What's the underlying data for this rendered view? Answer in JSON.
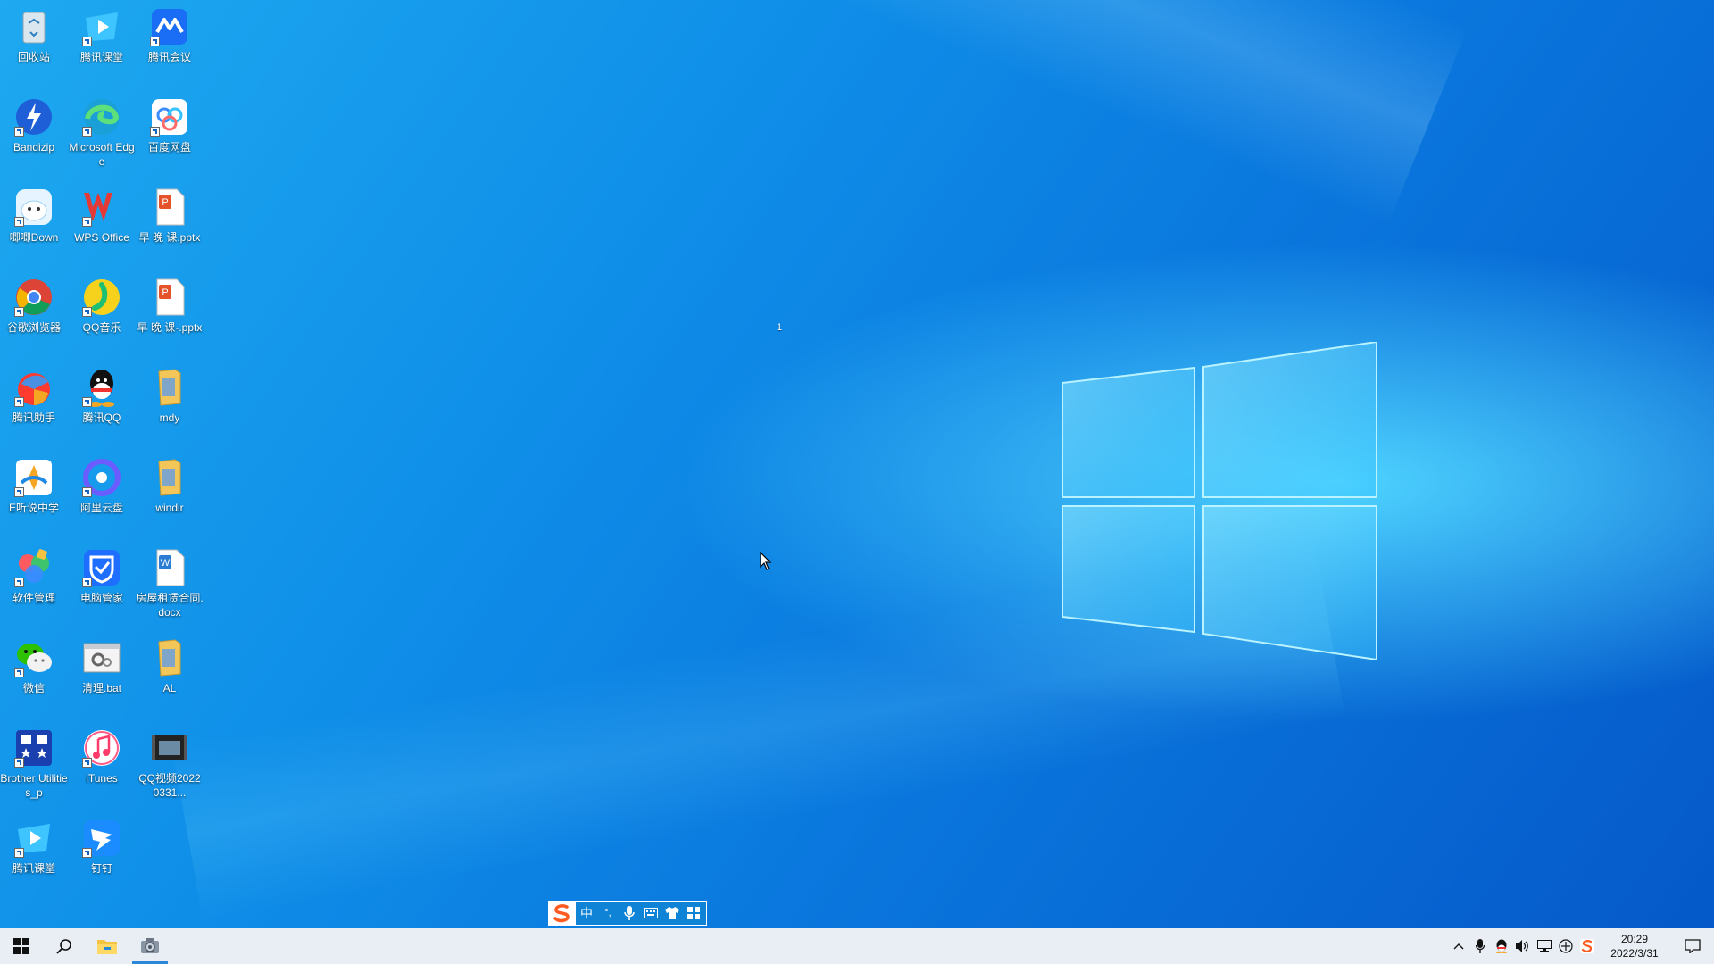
{
  "desktop": {
    "center_text": "1",
    "icons": [
      {
        "label": "回收站",
        "icon": "recycle-bin-icon",
        "shortcut": false
      },
      {
        "label": "腾讯课堂",
        "icon": "tencent-classroom-icon",
        "shortcut": true
      },
      {
        "label": "腾讯会议",
        "icon": "tencent-meeting-icon",
        "shortcut": true
      },
      {
        "label": "Bandizip",
        "icon": "bandizip-icon",
        "shortcut": true
      },
      {
        "label": "Microsoft Edge",
        "icon": "edge-icon",
        "shortcut": true
      },
      {
        "label": "百度网盘",
        "icon": "baidu-netdisk-icon",
        "shortcut": true
      },
      {
        "label": "唧唧Down",
        "icon": "jijidown-icon",
        "shortcut": true
      },
      {
        "label": "WPS Office",
        "icon": "wps-office-icon",
        "shortcut": true
      },
      {
        "label": "早 晚 课.pptx",
        "icon": "pptx-file-icon",
        "shortcut": false
      },
      {
        "label": "谷歌浏览器",
        "icon": "chrome-icon",
        "shortcut": true
      },
      {
        "label": "QQ音乐",
        "icon": "qq-music-icon",
        "shortcut": true
      },
      {
        "label": "早 晚 课-.pptx",
        "icon": "pptx-file-icon",
        "shortcut": false
      },
      {
        "label": "腾讯助手",
        "icon": "tencent-assistant-icon",
        "shortcut": true
      },
      {
        "label": "腾讯QQ",
        "icon": "qq-icon",
        "shortcut": true
      },
      {
        "label": "mdy",
        "icon": "folder-icon",
        "shortcut": false
      },
      {
        "label": "E听说中学",
        "icon": "etingshuo-icon",
        "shortcut": true
      },
      {
        "label": "阿里云盘",
        "icon": "aliyun-drive-icon",
        "shortcut": true
      },
      {
        "label": "windir",
        "icon": "folder-icon",
        "shortcut": false
      },
      {
        "label": "软件管理",
        "icon": "software-manager-icon",
        "shortcut": true
      },
      {
        "label": "电脑管家",
        "icon": "pc-manager-icon",
        "shortcut": true
      },
      {
        "label": "房屋租赁合同.docx",
        "icon": "docx-file-icon",
        "shortcut": false
      },
      {
        "label": "微信",
        "icon": "wechat-icon",
        "shortcut": true
      },
      {
        "label": "清理.bat",
        "icon": "bat-file-icon",
        "shortcut": false
      },
      {
        "label": "AL",
        "icon": "folder-icon",
        "shortcut": false
      },
      {
        "label": "Brother Utilities_p",
        "icon": "brother-utilities-icon",
        "shortcut": true
      },
      {
        "label": "iTunes",
        "icon": "itunes-icon",
        "shortcut": true
      },
      {
        "label": "QQ视频20220331...",
        "icon": "video-file-icon",
        "shortcut": false
      },
      {
        "label": "腾讯课堂",
        "icon": "tencent-classroom-icon",
        "shortcut": true
      },
      {
        "label": "钉钉",
        "icon": "dingtalk-icon",
        "shortcut": true
      }
    ]
  },
  "ime_bar": {
    "logo": "sogou-ime-icon",
    "mode": "中",
    "punct": "°,",
    "items": [
      "microphone-icon",
      "keyboard-icon",
      "skin-icon",
      "toolbox-icon"
    ]
  },
  "taskbar": {
    "start": "windows-start-icon",
    "search": "search-icon",
    "pinned": [
      "file-explorer-icon",
      "camera-app-icon"
    ],
    "tray": [
      "chevron-up-icon",
      "microphone-icon",
      "qq-tray-icon",
      "volume-icon",
      "network-icon",
      "input-method-icon",
      "sogou-tray-icon"
    ],
    "clock_time": "20:29",
    "clock_date": "2022/3/31",
    "notification": "notification-icon"
  },
  "colors": {
    "desktop_bg": "#0f8ee8",
    "taskbar_bg": "#e8eef3",
    "accent": "#2b88d8"
  }
}
